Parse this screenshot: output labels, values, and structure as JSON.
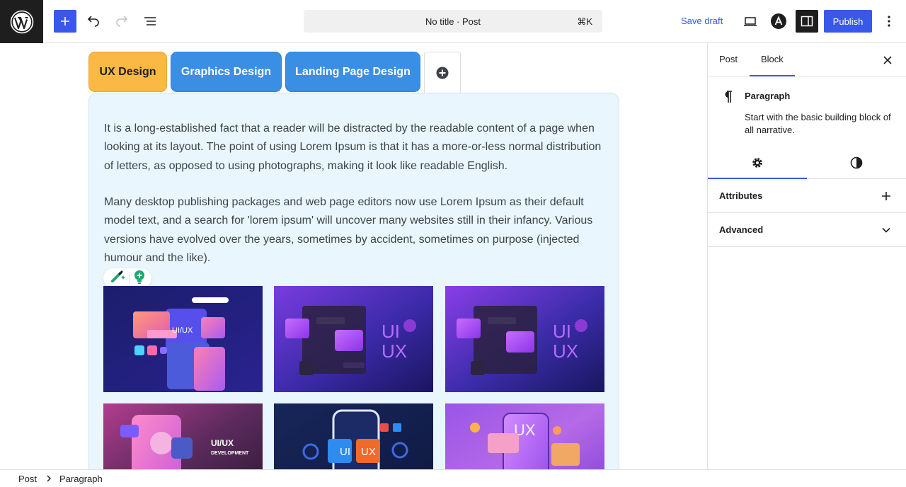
{
  "topbar": {
    "command_bar_label": "No title · Post",
    "command_shortcut": "⌘K",
    "save_draft_label": "Save draft",
    "publish_label": "Publish",
    "accent_color": "#3858e9"
  },
  "tabs": {
    "items": [
      {
        "label": "UX Design",
        "color": "#f9b944"
      },
      {
        "label": "Graphics Design",
        "color": "#3a8fe4"
      },
      {
        "label": "Landing Page Design",
        "color": "#3a8fe4"
      }
    ]
  },
  "content": {
    "paragraph_1": "It is a long-established fact that a reader will be distracted by the readable content of a page when looking at its layout. The point of using Lorem Ipsum is that it has a more-or-less normal distribution of letters, as opposed to using photographs, making it look like readable English.",
    "paragraph_2": "Many desktop publishing packages and web page editors now use Lorem Ipsum as their default model text, and a search for 'lorem ipsum' will uncover many websites still in their infancy. Various versions have evolved over the years, sometimes by accident, sometimes on purpose (injected humour and the like).",
    "panel_background": "#eaf6fd"
  },
  "gallery": {
    "tile_1_text": "UI/UX",
    "tile_2_text": [
      "UI",
      "UX"
    ],
    "tile_3_text": [
      "UI",
      "UX"
    ],
    "tile_4_text": [
      "UI/UX",
      "DEVELOPMENT"
    ],
    "tile_5_text": [
      "UI",
      "UX"
    ],
    "tile_6_text": "UX"
  },
  "sidebar": {
    "tab_post": "Post",
    "tab_block": "Block",
    "block_name": "Paragraph",
    "block_description": "Start with the basic building block of all narrative.",
    "panels": [
      {
        "label": "Attributes",
        "control": "plus-icon"
      },
      {
        "label": "Advanced",
        "control": "chevron-down-icon"
      }
    ]
  },
  "footer": {
    "breadcrumb": [
      "Post",
      "Paragraph"
    ]
  }
}
